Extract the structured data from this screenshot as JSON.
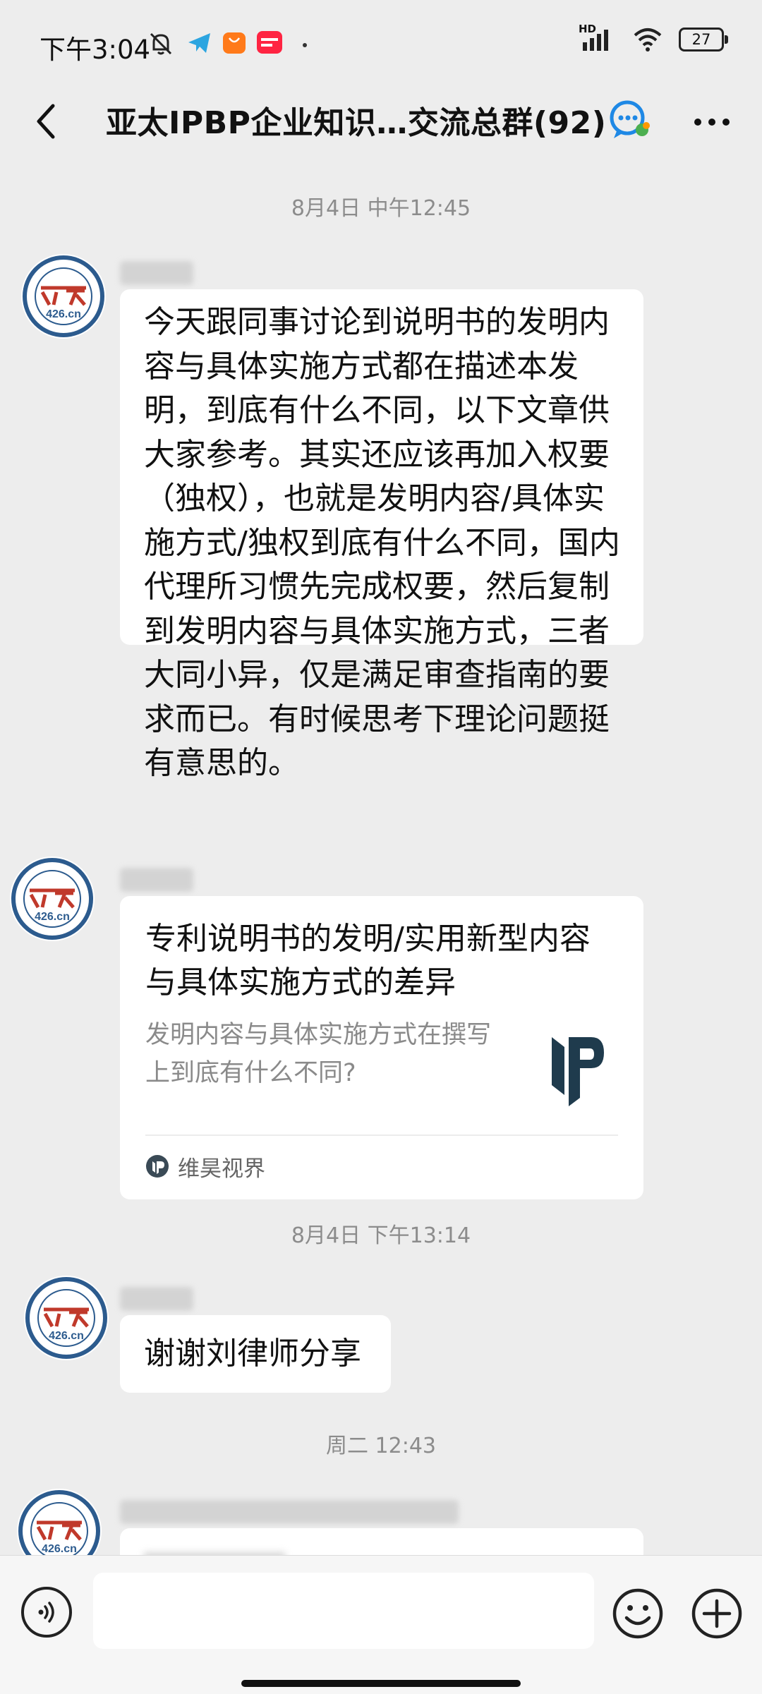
{
  "status_bar": {
    "time": "下午3:04",
    "network": "HD",
    "battery": "27"
  },
  "header": {
    "title": "亚太IPBP企业知识…交流总群(92)"
  },
  "avatar_text": {
    "org": "426.cn"
  },
  "chat": {
    "timestamps": [
      "8月4日 中午12:45",
      "8月4日 下午13:14",
      "周二 12:43"
    ],
    "message1": "今天跟同事讨论到说明书的发明内容与具体实施方式都在描述本发明，到底有什么不同，以下文章供大家参考。其实还应该再加入权要（独权），也就是发明内容/具体实施方式/独权到底有什么不同，国内代理所习惯先完成权要，然后复制到发明内容与具体实施方式，三者大同小异，仅是满足审查指南的要求而已。有时候思考下理论问题挺有意思的。",
    "card": {
      "title": "专利说明书的发明/实用新型内容与具体实施方式的差异",
      "description": "发明内容与具体实施方式在撰写上到底有什么不同?",
      "source": "维昊视界"
    },
    "message3": "谢谢刘律师分享"
  },
  "colors": {
    "background": "#ededed",
    "bubble": "#ffffff",
    "avatar_ring": "#2c5b8e",
    "avatar_accent": "#c0392b",
    "card_logo": "#1f3b4d"
  }
}
